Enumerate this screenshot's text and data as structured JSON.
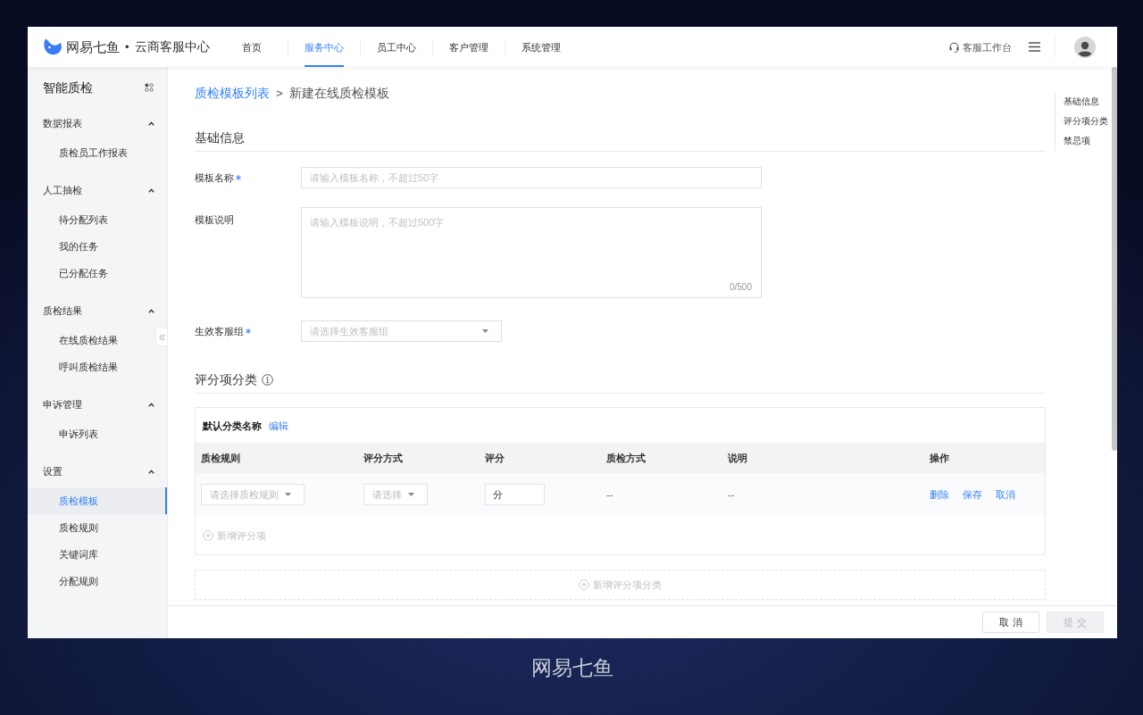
{
  "header": {
    "logo": {
      "brand": "网易七鱼",
      "separator": "•",
      "product": "云商客服中心"
    },
    "nav": [
      {
        "label": "首页",
        "selected": false
      },
      {
        "label": "服务中心",
        "selected": true
      },
      {
        "label": "员工中心",
        "selected": false
      },
      {
        "label": "客户管理",
        "selected": false
      },
      {
        "label": "系统管理",
        "selected": false
      }
    ],
    "workbench": "客服工作台"
  },
  "sidebar": {
    "title": "智能质检",
    "groups": [
      {
        "label": "数据报表",
        "expanded": true,
        "items": [
          {
            "label": "质检员工作报表",
            "selected": false
          }
        ]
      },
      {
        "label": "人工抽检",
        "expanded": true,
        "items": [
          {
            "label": "待分配列表",
            "selected": false
          },
          {
            "label": "我的任务",
            "selected": false
          },
          {
            "label": "已分配任务",
            "selected": false
          }
        ]
      },
      {
        "label": "质检结果",
        "expanded": true,
        "items": [
          {
            "label": "在线质检结果",
            "selected": false
          },
          {
            "label": "呼叫质检结果",
            "selected": false
          }
        ]
      },
      {
        "label": "申诉管理",
        "expanded": true,
        "items": [
          {
            "label": "申诉列表",
            "selected": false
          }
        ]
      },
      {
        "label": "设置",
        "expanded": true,
        "items": [
          {
            "label": "质检模板",
            "selected": true
          },
          {
            "label": "质检规则",
            "selected": false
          },
          {
            "label": "关键词库",
            "selected": false
          },
          {
            "label": "分配规则",
            "selected": false
          }
        ]
      }
    ]
  },
  "breadcrumb": {
    "parent": "质检模板列表",
    "separator": ">",
    "current": "新建在线质检模板"
  },
  "basic_info": {
    "title": "基础信息",
    "fields": [
      {
        "kind": "input",
        "label": "模板名称",
        "required": true,
        "placeholder": "请输入模板名称，不超过50字"
      },
      {
        "kind": "textarea",
        "label": "模板说明",
        "required": false,
        "placeholder": "请输入模板说明，不超过500字",
        "counter": "0/500"
      },
      {
        "kind": "select",
        "label": "生效客服组",
        "required": true,
        "placeholder": "请选择生效客服组"
      }
    ]
  },
  "scoring": {
    "title": "评分项分类",
    "categories": [
      {
        "name": "默认分类名称",
        "edit": "编辑",
        "columns": [
          "质检规则",
          "评分方式",
          "评分",
          "质检方式",
          "说明",
          "操作"
        ],
        "rows": [
          {
            "cells": [
              {
                "kind": "select",
                "placeholder": "请选择质检规则"
              },
              {
                "kind": "select",
                "placeholder": "请选择"
              },
              {
                "kind": "input",
                "value": "分"
              },
              {
                "kind": "text",
                "text": "--"
              },
              {
                "kind": "text",
                "text": "--"
              },
              {
                "kind": "actions",
                "actions": [
                  "删除",
                  "保存",
                  "取消"
                ]
              }
            ]
          }
        ],
        "add_item": {
          "label": "新增评分项",
          "disabled": true
        }
      }
    ],
    "add_category": {
      "label": "新增评分项分类",
      "disabled": true
    }
  },
  "anchors": [
    "基础信息",
    "评分项分类",
    "禁忌项"
  ],
  "footer": {
    "buttons": [
      {
        "label": "取 消",
        "disabled": false
      },
      {
        "label": "提 交",
        "disabled": true
      }
    ]
  },
  "caption": "网易七鱼"
}
